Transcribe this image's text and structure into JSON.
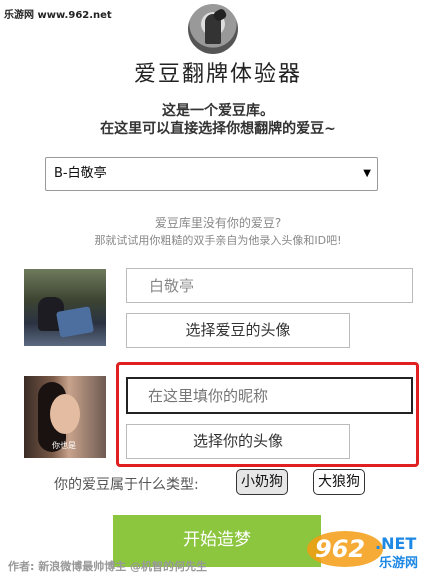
{
  "watermark_top": "乐游网 www.962.net",
  "title": "爱豆翻牌体验器",
  "intro": {
    "line1": "这是一个爱豆库。",
    "line2": "在这里可以直接选择你想翻牌的爱豆~"
  },
  "idol_select": {
    "selected": "B-白敬亭"
  },
  "hint": {
    "line1": "爱豆库里没有你的爱豆?",
    "line2": "那就试试用你粗糙的双手亲自为他录入头像和ID吧!"
  },
  "idol_name_input": {
    "value": "白敬亭"
  },
  "choose_idol_avatar_label": "选择爱豆的头像",
  "my_name_input": {
    "placeholder": "在这里填你的昵称"
  },
  "photo2_caption": "你也是",
  "choose_my_avatar_label": "选择你的头像",
  "type_question": "你的爱豆属于什么类型:",
  "type_options": [
    "小奶狗",
    "大狼狗"
  ],
  "start_button": "开始造梦",
  "author": "作者: 新浪微博最帅博主 @机智的何先生",
  "logo": {
    "text": "962",
    "suffix": ".NET",
    "brand": "乐游网"
  },
  "colors": {
    "accent_green": "#8cc63f",
    "highlight_red": "#e02020",
    "logo_orange": "#f39c12"
  }
}
